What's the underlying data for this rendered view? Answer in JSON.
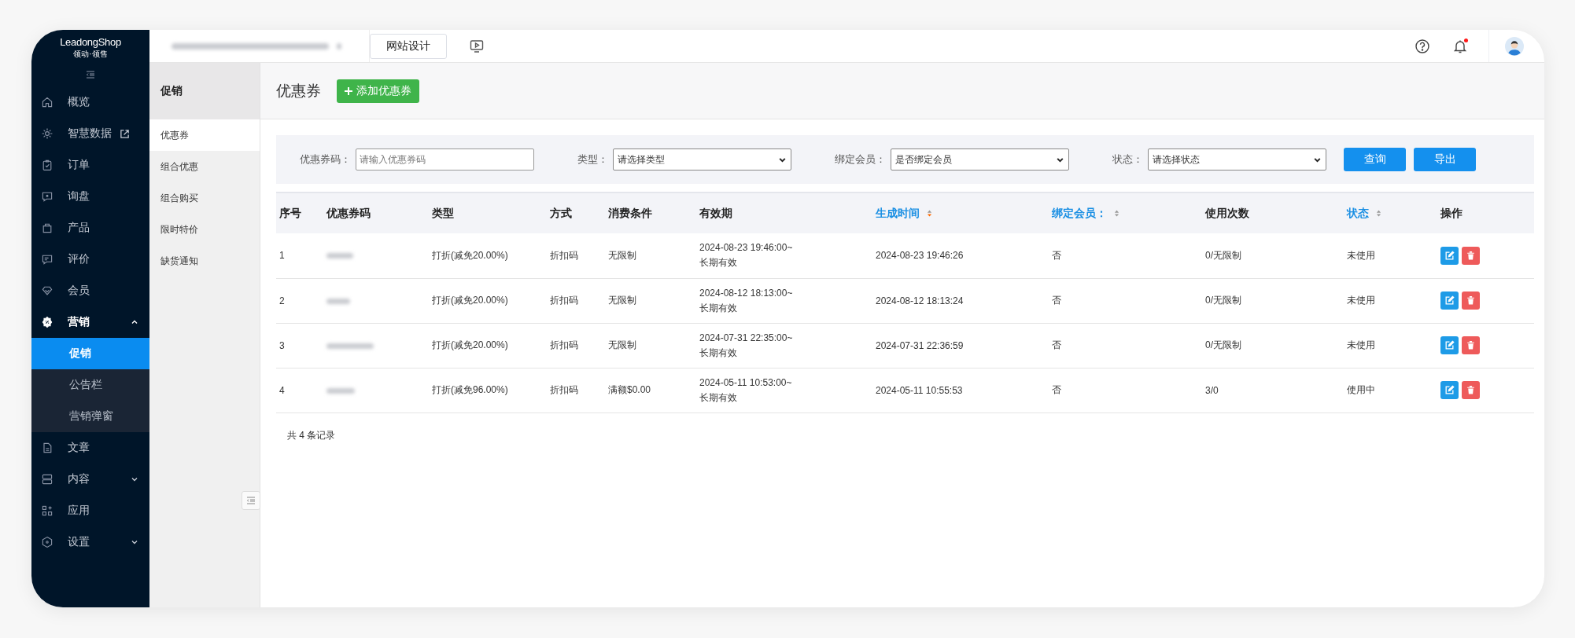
{
  "logo": {
    "name": "LeadongShop",
    "tagline": "领动·领售"
  },
  "sidebar": {
    "items": [
      {
        "label": "概览",
        "kind": "link"
      },
      {
        "label": "智慧数据",
        "kind": "link",
        "external": true
      },
      {
        "label": "订单",
        "kind": "link"
      },
      {
        "label": "询盘",
        "kind": "link"
      },
      {
        "label": "产品",
        "kind": "link"
      },
      {
        "label": "评价",
        "kind": "link"
      },
      {
        "label": "会员",
        "kind": "link"
      },
      {
        "label": "营销",
        "kind": "group",
        "expanded": true,
        "children": [
          {
            "label": "促销",
            "selected": true
          },
          {
            "label": "公告栏",
            "selected": false
          },
          {
            "label": "营销弹窗",
            "selected": false
          }
        ]
      },
      {
        "label": "文章",
        "kind": "link"
      },
      {
        "label": "内容",
        "kind": "group",
        "expanded": false
      },
      {
        "label": "应用",
        "kind": "link"
      },
      {
        "label": "设置",
        "kind": "group",
        "expanded": false
      }
    ]
  },
  "top_bar": {
    "design_button": "网站设计",
    "notification": true
  },
  "sub_nav": {
    "title": "促销",
    "items": [
      {
        "label": "优惠券",
        "selected": true
      },
      {
        "label": "组合优惠",
        "selected": false
      },
      {
        "label": "组合购买",
        "selected": false
      },
      {
        "label": "限时特价",
        "selected": false
      },
      {
        "label": "缺货通知",
        "selected": false
      }
    ]
  },
  "page": {
    "title": "优惠券",
    "add_button": "添加优惠券"
  },
  "filters": [
    {
      "label": "优惠券码：",
      "kind": "input",
      "placeholder": "请输入优惠券码"
    },
    {
      "label": "类型：",
      "kind": "select",
      "value": "请选择类型"
    },
    {
      "label": "绑定会员：",
      "kind": "select",
      "value": "是否绑定会员"
    },
    {
      "label": "状态：",
      "kind": "select",
      "value": "请选择状态"
    }
  ],
  "filter_buttons": [
    "查询",
    "导出"
  ],
  "table": {
    "columns": [
      {
        "label": "序号",
        "sortable": false
      },
      {
        "label": "优惠券码",
        "sortable": false
      },
      {
        "label": "类型",
        "sortable": false
      },
      {
        "label": "方式",
        "sortable": false
      },
      {
        "label": "消费条件",
        "sortable": false
      },
      {
        "label": "有效期",
        "sortable": false
      },
      {
        "label": "生成时间",
        "sortable": true,
        "sorted": true
      },
      {
        "label": "绑定会员：",
        "sortable": true,
        "sorted": false
      },
      {
        "label": "使用次数",
        "sortable": false
      },
      {
        "label": "状态",
        "sortable": true,
        "sorted": false
      },
      {
        "label": "操作",
        "sortable": false
      }
    ],
    "rows": [
      {
        "no": "1",
        "type": "打折(减免20.00%)",
        "method": "折扣码",
        "condition": "无限制",
        "validity": "2024-08-23 19:46:00~\n长期有效",
        "created": "2024-08-23 19:46:26",
        "member": "否",
        "uses": "0/无限制",
        "status": "未使用"
      },
      {
        "no": "2",
        "type": "打折(减免20.00%)",
        "method": "折扣码",
        "condition": "无限制",
        "validity": "2024-08-12 18:13:00~\n长期有效",
        "created": "2024-08-12 18:13:24",
        "member": "否",
        "uses": "0/无限制",
        "status": "未使用"
      },
      {
        "no": "3",
        "type": "打折(减免20.00%)",
        "method": "折扣码",
        "condition": "无限制",
        "validity": "2024-07-31 22:35:00~\n长期有效",
        "created": "2024-07-31 22:36:59",
        "member": "否",
        "uses": "0/无限制",
        "status": "未使用"
      },
      {
        "no": "4",
        "type": "打折(减免96.00%)",
        "method": "折扣码",
        "condition": "满额$0.00",
        "validity": "2024-05-11 10:53:00~\n长期有效",
        "created": "2024-05-11 10:55:53",
        "member": "否",
        "uses": "3/0",
        "status": "使用中"
      }
    ],
    "footer": "共 4 条记录"
  }
}
